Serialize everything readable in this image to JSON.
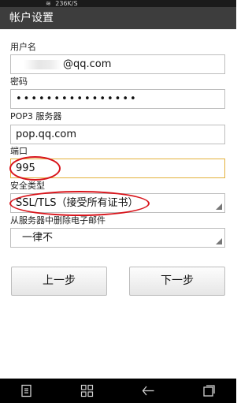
{
  "status_bar": {
    "speed": "236K/S"
  },
  "title": "帐户设置",
  "form": {
    "username_label": "用户名",
    "username_value_suffix": "@qq.com",
    "password_label": "密码",
    "password_value": "••••••••••••••••",
    "pop3_label": "POP3 服务器",
    "pop3_value": "pop.qq.com",
    "port_label": "端口",
    "port_value": "995",
    "security_label": "安全类型",
    "security_value": "SSL/TLS（接受所有证书）",
    "delete_label": "从服务器中删除电子邮件",
    "delete_value": "一律不"
  },
  "buttons": {
    "prev": "上一步",
    "next": "下一步"
  },
  "colors": {
    "annotation": "#d8141b",
    "focus_border": "#e3b23c",
    "title_bar": "#3d3d3d"
  }
}
